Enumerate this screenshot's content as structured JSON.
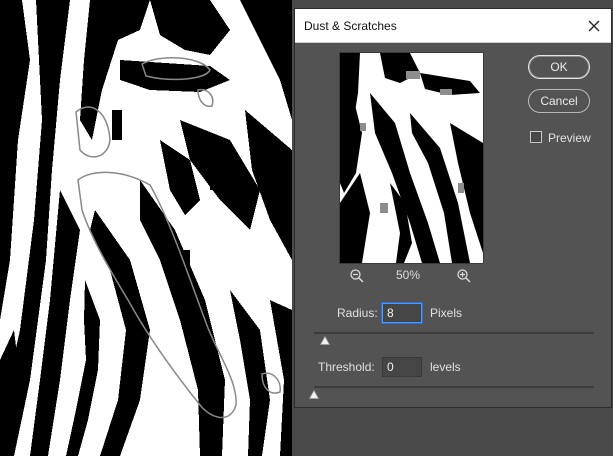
{
  "dialog": {
    "title": "Dust & Scratches",
    "ok_label": "OK",
    "cancel_label": "Cancel",
    "preview_label": "Preview",
    "preview_checked": false,
    "zoom_level": "50%",
    "radius": {
      "label": "Radius:",
      "value": "8",
      "unit": "Pixels",
      "slider_fraction": 0.04
    },
    "threshold": {
      "label": "Threshold:",
      "value": "0",
      "unit": "levels",
      "slider_fraction": 0.0
    }
  },
  "icons": {
    "close": "close-icon",
    "zoom_out": "zoom-out-icon",
    "zoom_in": "zoom-in-icon"
  },
  "colors": {
    "dialog_bg": "#535353",
    "canvas_bg": "#ffffff",
    "focus_blue": "#4b9bff"
  }
}
